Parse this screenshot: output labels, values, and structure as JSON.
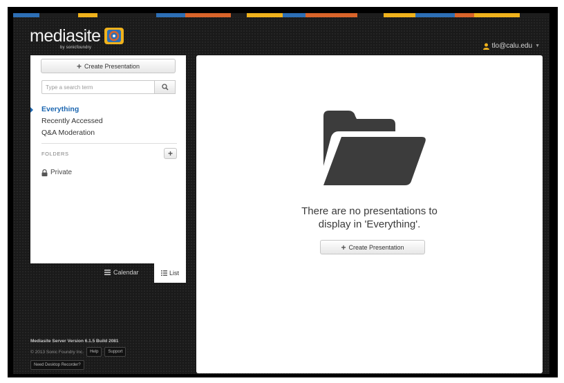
{
  "brand": {
    "name": "mediasite",
    "sub": "by sonicfoundry"
  },
  "header": {
    "user_email": "tlo@calu.edu",
    "stripe_colors": [
      "#2d6fb5",
      "#1d1d1d",
      "#f0b21c",
      "#1d1d1d",
      "#2d6fb5",
      "#d9642a",
      "#1d1d1d",
      "#f0b21c",
      "#2d6fb5",
      "#d9642a",
      "#1d1d1d",
      "#f0b21c",
      "#2d6fb5",
      "#d9642a",
      "#f0b21c",
      "#1d1d1d"
    ]
  },
  "sidebar": {
    "create_label": "Create Presentation",
    "search_placeholder": "Type a search term",
    "nav_items": [
      {
        "label": "Everything",
        "active": true
      },
      {
        "label": "Recently Accessed",
        "active": false
      },
      {
        "label": "Q&A Moderation",
        "active": false
      }
    ],
    "folders_label": "FOLDERS",
    "private_label": "Private"
  },
  "view_toggle": {
    "calendar_label": "Calendar",
    "list_label": "List"
  },
  "main": {
    "empty_line1": "There are no presentations to",
    "empty_line2": "display in 'Everything'.",
    "create_label": "Create Presentation"
  },
  "footer": {
    "version": "Mediasite Server Version 6.1.5 Build 2081",
    "copyright": "© 2013 Sonic Foundry Inc.",
    "help_label": "Help",
    "support_label": "Support",
    "recorder_label": "Need Desktop Recorder?"
  },
  "colors": {
    "accent": "#1b66b0",
    "background": "#1a1a1a"
  }
}
